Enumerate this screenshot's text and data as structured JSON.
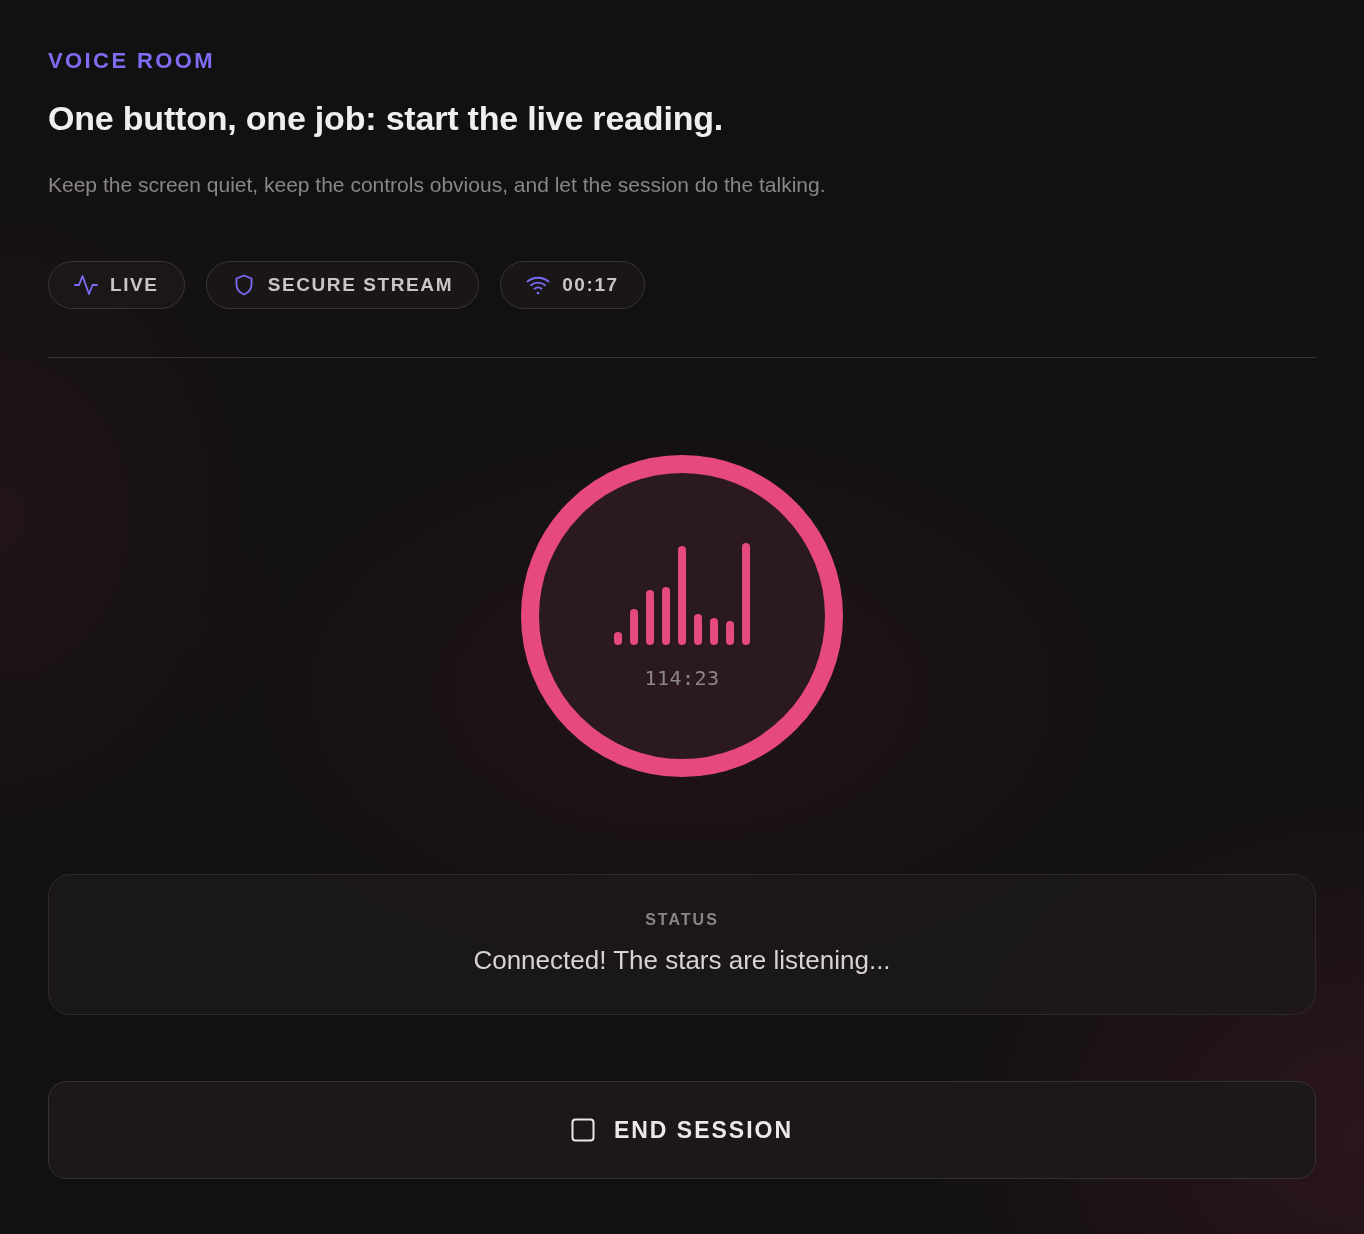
{
  "header": {
    "eyebrow": "VOICE ROOM",
    "title": "One button, one job: start the live reading.",
    "subtitle": "Keep the screen quiet, keep the controls obvious, and let the session do the talking."
  },
  "chips": [
    {
      "kind": "activity",
      "label": "LIVE"
    },
    {
      "kind": "shield",
      "label": "SECURE STREAM"
    },
    {
      "kind": "wifi",
      "label": "00:17"
    }
  ],
  "record_button": {
    "elapsed": "114:23"
  },
  "status_panel": {
    "heading": "STATUS",
    "message": "Connected! The stars are listening..."
  },
  "end_button": {
    "label": "END SESSION"
  }
}
